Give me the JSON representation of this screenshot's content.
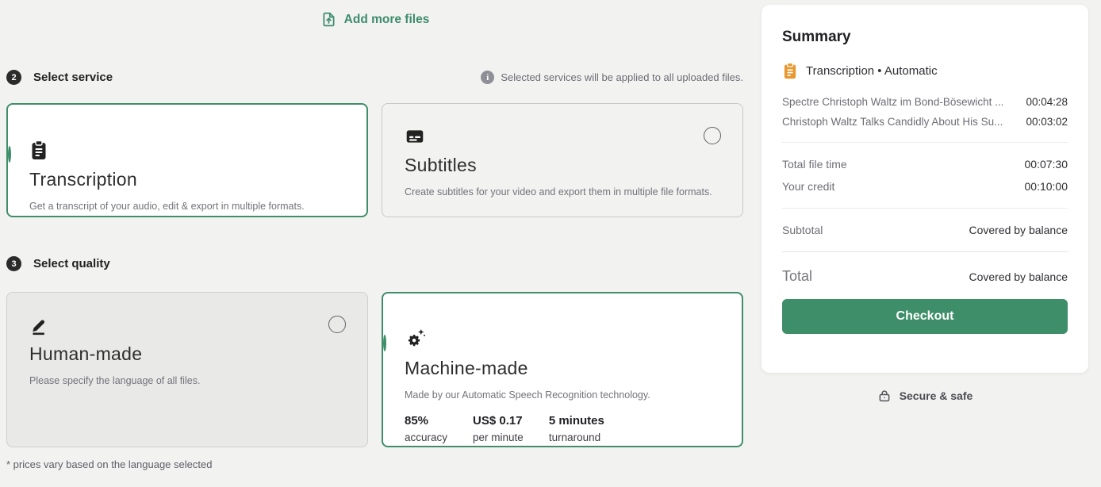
{
  "colors": {
    "accent_green": "#3d8c6c",
    "button_green": "#3e8e69",
    "badge_dark": "#2b2b2b",
    "summary_icon_orange": "#e8982e",
    "page_background": "#f2f2f1"
  },
  "add_files": {
    "label": "Add more files"
  },
  "sections": [
    {
      "number": "2",
      "title": "Select service",
      "note": "Selected services will be applied to all uploaded files."
    },
    {
      "number": "3",
      "title": "Select quality"
    }
  ],
  "service_cards": [
    {
      "id": "transcription",
      "icon": "clipboard-icon",
      "title": "Transcription",
      "description": "Get a transcript of your audio, edit & export in multiple formats.",
      "selected": true
    },
    {
      "id": "subtitles",
      "icon": "subtitles-icon",
      "title": "Subtitles",
      "description": "Create subtitles for your video and export them in multiple file formats.",
      "selected": false
    }
  ],
  "quality_cards": [
    {
      "id": "human-made",
      "icon": "pencil-icon",
      "title": "Human-made",
      "description": "Please specify the language of all files.",
      "selected": false
    },
    {
      "id": "machine-made",
      "icon": "gear-sparkle-icon",
      "title": "Machine-made",
      "description": "Made by our Automatic Speech Recognition technology.",
      "selected": true,
      "stats": [
        {
          "value": "85%",
          "label": "accuracy"
        },
        {
          "value": "US$ 0.17",
          "label": "per minute"
        },
        {
          "value": "5 minutes",
          "label": "turnaround"
        }
      ]
    }
  ],
  "footnote": "* prices vary based on the language selected",
  "summary": {
    "title": "Summary",
    "service_line": "Transcription • Automatic",
    "files": [
      {
        "name": "Spectre Christoph Waltz im Bond-Bösewicht ...",
        "duration": "00:04:28"
      },
      {
        "name": "Christoph Waltz Talks Candidly About His Su...",
        "duration": "00:03:02"
      }
    ],
    "rows": [
      {
        "label": "Total file time",
        "value": "00:07:30"
      },
      {
        "label": "Your credit",
        "value": "00:10:00"
      }
    ],
    "subtotal_label": "Subtotal",
    "subtotal_value": "Covered by balance",
    "total_label": "Total",
    "total_value": "Covered by balance",
    "checkout_label": "Checkout",
    "secure_label": "Secure & safe"
  }
}
